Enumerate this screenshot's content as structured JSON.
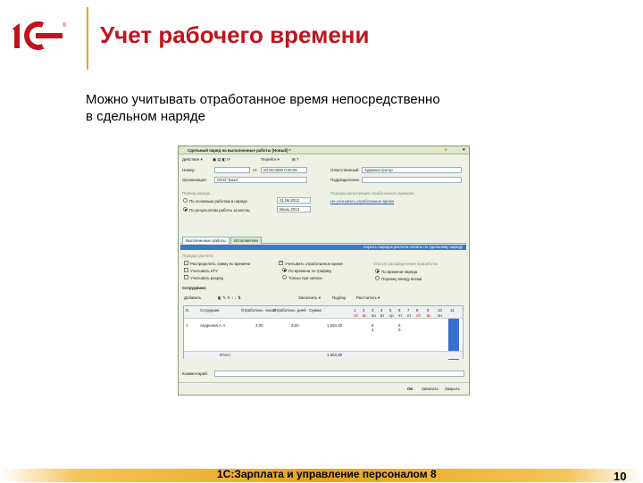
{
  "slide": {
    "title": "Учет рабочего времени",
    "subtitle_line1": "Можно учитывать отработанное время непосредственно",
    "subtitle_line2": "в сдельном наряде",
    "footer": "1С:Зарплата и управление персоналом 8",
    "page_number": "10"
  },
  "window": {
    "title": "Сдельный наряд на выполненные работы (Новый) *",
    "toolbar": [
      "Действия ▾",
      "Перейти ▾"
    ],
    "number_label": "Номер:",
    "number_value": "",
    "date_prefix": "от:",
    "date_value": "00.00.0000 0:00:00",
    "org_label": "Организация:",
    "org_value": "ООО \"База\"",
    "responsible_label": "Ответственный:",
    "responsible_value": "Администратор",
    "division_label": "Подразделение:",
    "division_value": "",
    "group_period": "Период наряда",
    "radio_by_work": "По основным работам в наряде",
    "radio_by_period": "По результатам работы за месяц",
    "date_from": "01.06.2013",
    "month_value": "Июнь 2013",
    "group_registration": "Порядок регистрации отработанного времени",
    "registration_text": "Не учитывать отработанное время",
    "tab1": "Выполненные работы",
    "tab2": "Исполнители",
    "blueband_text": "Скрыть порядок расчета оплаты по сдельному наряду",
    "group_calc": "Порядок расчета",
    "chk1": "Распределять сумму по времени",
    "chk2": "Учитывать КТУ",
    "chk3": "Учитывать разряд",
    "chk4": "Учитывать отработанное время",
    "radio2a": "По времени по графику",
    "radio2b": "Только при записи",
    "group_distribute": "Способ распределения приработка",
    "radio3a": "По времени наряда",
    "radio3b": "Поровну между всеми",
    "executors_label": "Сотрудники:",
    "grid_toolbar": [
      "Добавить",
      "Заполнить ▾",
      "Подбор",
      "Рассчитать ▾"
    ],
    "grid_headers": [
      "N",
      "Сотрудник",
      "Отработано, часов",
      "Отработано, дней",
      "Сумма",
      "1",
      "2",
      "3",
      "4",
      "5",
      "6",
      "7",
      "8",
      "9",
      "10",
      "11"
    ],
    "grid_header_days": [
      "сб",
      "вс",
      "пн",
      "вт",
      "ср",
      "чт",
      "пт",
      "сб",
      "вс",
      "пн",
      "вт"
    ],
    "row": {
      "num": "1",
      "name": "Андреева А.А",
      "hours": "3,00",
      "days": "3,00",
      "sum": "1 563,30",
      "d3": "8",
      "d3b": "4",
      "d6": "8",
      "d6b": "0"
    },
    "total_label": "Итого:",
    "total_sum": "1 563,30",
    "comment_label": "Комментарий:",
    "footer_buttons": [
      "OK",
      "Записать",
      "Закрыть"
    ]
  }
}
